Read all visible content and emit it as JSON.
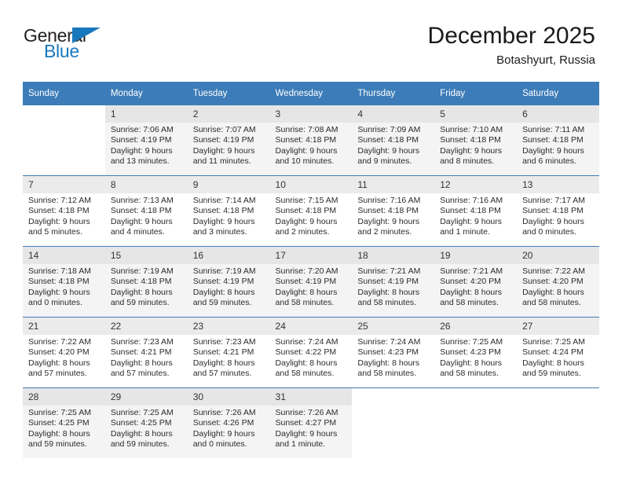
{
  "brand": {
    "name_top": "General",
    "name_bottom": "Blue",
    "flag_icon": "blue-triangle-flag-icon",
    "accent_color": "#1878be"
  },
  "header": {
    "title": "December 2025",
    "subtitle": "Botashyurt, Russia"
  },
  "calendar": {
    "header_bg": "#3c7cb8",
    "weekdays": [
      "Sunday",
      "Monday",
      "Tuesday",
      "Wednesday",
      "Thursday",
      "Friday",
      "Saturday"
    ],
    "weeks": [
      [
        {
          "day": "",
          "lines": []
        },
        {
          "day": "1",
          "lines": [
            "Sunrise: 7:06 AM",
            "Sunset: 4:19 PM",
            "Daylight: 9 hours",
            "and 13 minutes."
          ]
        },
        {
          "day": "2",
          "lines": [
            "Sunrise: 7:07 AM",
            "Sunset: 4:19 PM",
            "Daylight: 9 hours",
            "and 11 minutes."
          ]
        },
        {
          "day": "3",
          "lines": [
            "Sunrise: 7:08 AM",
            "Sunset: 4:18 PM",
            "Daylight: 9 hours",
            "and 10 minutes."
          ]
        },
        {
          "day": "4",
          "lines": [
            "Sunrise: 7:09 AM",
            "Sunset: 4:18 PM",
            "Daylight: 9 hours",
            "and 9 minutes."
          ]
        },
        {
          "day": "5",
          "lines": [
            "Sunrise: 7:10 AM",
            "Sunset: 4:18 PM",
            "Daylight: 9 hours",
            "and 8 minutes."
          ]
        },
        {
          "day": "6",
          "lines": [
            "Sunrise: 7:11 AM",
            "Sunset: 4:18 PM",
            "Daylight: 9 hours",
            "and 6 minutes."
          ]
        }
      ],
      [
        {
          "day": "7",
          "lines": [
            "Sunrise: 7:12 AM",
            "Sunset: 4:18 PM",
            "Daylight: 9 hours",
            "and 5 minutes."
          ]
        },
        {
          "day": "8",
          "lines": [
            "Sunrise: 7:13 AM",
            "Sunset: 4:18 PM",
            "Daylight: 9 hours",
            "and 4 minutes."
          ]
        },
        {
          "day": "9",
          "lines": [
            "Sunrise: 7:14 AM",
            "Sunset: 4:18 PM",
            "Daylight: 9 hours",
            "and 3 minutes."
          ]
        },
        {
          "day": "10",
          "lines": [
            "Sunrise: 7:15 AM",
            "Sunset: 4:18 PM",
            "Daylight: 9 hours",
            "and 2 minutes."
          ]
        },
        {
          "day": "11",
          "lines": [
            "Sunrise: 7:16 AM",
            "Sunset: 4:18 PM",
            "Daylight: 9 hours",
            "and 2 minutes."
          ]
        },
        {
          "day": "12",
          "lines": [
            "Sunrise: 7:16 AM",
            "Sunset: 4:18 PM",
            "Daylight: 9 hours",
            "and 1 minute."
          ]
        },
        {
          "day": "13",
          "lines": [
            "Sunrise: 7:17 AM",
            "Sunset: 4:18 PM",
            "Daylight: 9 hours",
            "and 0 minutes."
          ]
        }
      ],
      [
        {
          "day": "14",
          "lines": [
            "Sunrise: 7:18 AM",
            "Sunset: 4:18 PM",
            "Daylight: 9 hours",
            "and 0 minutes."
          ]
        },
        {
          "day": "15",
          "lines": [
            "Sunrise: 7:19 AM",
            "Sunset: 4:18 PM",
            "Daylight: 8 hours",
            "and 59 minutes."
          ]
        },
        {
          "day": "16",
          "lines": [
            "Sunrise: 7:19 AM",
            "Sunset: 4:19 PM",
            "Daylight: 8 hours",
            "and 59 minutes."
          ]
        },
        {
          "day": "17",
          "lines": [
            "Sunrise: 7:20 AM",
            "Sunset: 4:19 PM",
            "Daylight: 8 hours",
            "and 58 minutes."
          ]
        },
        {
          "day": "18",
          "lines": [
            "Sunrise: 7:21 AM",
            "Sunset: 4:19 PM",
            "Daylight: 8 hours",
            "and 58 minutes."
          ]
        },
        {
          "day": "19",
          "lines": [
            "Sunrise: 7:21 AM",
            "Sunset: 4:20 PM",
            "Daylight: 8 hours",
            "and 58 minutes."
          ]
        },
        {
          "day": "20",
          "lines": [
            "Sunrise: 7:22 AM",
            "Sunset: 4:20 PM",
            "Daylight: 8 hours",
            "and 58 minutes."
          ]
        }
      ],
      [
        {
          "day": "21",
          "lines": [
            "Sunrise: 7:22 AM",
            "Sunset: 4:20 PM",
            "Daylight: 8 hours",
            "and 57 minutes."
          ]
        },
        {
          "day": "22",
          "lines": [
            "Sunrise: 7:23 AM",
            "Sunset: 4:21 PM",
            "Daylight: 8 hours",
            "and 57 minutes."
          ]
        },
        {
          "day": "23",
          "lines": [
            "Sunrise: 7:23 AM",
            "Sunset: 4:21 PM",
            "Daylight: 8 hours",
            "and 57 minutes."
          ]
        },
        {
          "day": "24",
          "lines": [
            "Sunrise: 7:24 AM",
            "Sunset: 4:22 PM",
            "Daylight: 8 hours",
            "and 58 minutes."
          ]
        },
        {
          "day": "25",
          "lines": [
            "Sunrise: 7:24 AM",
            "Sunset: 4:23 PM",
            "Daylight: 8 hours",
            "and 58 minutes."
          ]
        },
        {
          "day": "26",
          "lines": [
            "Sunrise: 7:25 AM",
            "Sunset: 4:23 PM",
            "Daylight: 8 hours",
            "and 58 minutes."
          ]
        },
        {
          "day": "27",
          "lines": [
            "Sunrise: 7:25 AM",
            "Sunset: 4:24 PM",
            "Daylight: 8 hours",
            "and 59 minutes."
          ]
        }
      ],
      [
        {
          "day": "28",
          "lines": [
            "Sunrise: 7:25 AM",
            "Sunset: 4:25 PM",
            "Daylight: 8 hours",
            "and 59 minutes."
          ]
        },
        {
          "day": "29",
          "lines": [
            "Sunrise: 7:25 AM",
            "Sunset: 4:25 PM",
            "Daylight: 8 hours",
            "and 59 minutes."
          ]
        },
        {
          "day": "30",
          "lines": [
            "Sunrise: 7:26 AM",
            "Sunset: 4:26 PM",
            "Daylight: 9 hours",
            "and 0 minutes."
          ]
        },
        {
          "day": "31",
          "lines": [
            "Sunrise: 7:26 AM",
            "Sunset: 4:27 PM",
            "Daylight: 9 hours",
            "and 1 minute."
          ]
        },
        {
          "day": "",
          "lines": []
        },
        {
          "day": "",
          "lines": []
        },
        {
          "day": "",
          "lines": []
        }
      ]
    ]
  }
}
